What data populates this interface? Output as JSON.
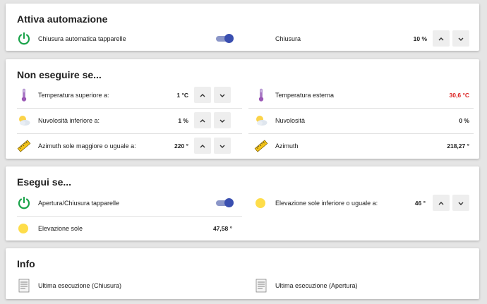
{
  "cards": {
    "automation": {
      "title": "Attiva automazione",
      "auto_close_label": "Chiusura automatica tapparelle",
      "close_label": "Chiusura",
      "close_value": "10 %"
    },
    "do_not_run": {
      "title": "Non eseguire se...",
      "temp_above_label": "Temperatura superiore a:",
      "temp_above_value": "1 °C",
      "temp_ext_label": "Temperatura esterna",
      "temp_ext_value": "30,6 °C",
      "cloud_below_label": "Nuvolosità inferiore a:",
      "cloud_below_value": "1 %",
      "cloud_label": "Nuvolosità",
      "cloud_value": "0 %",
      "azimuth_ge_label": "Azimuth sole maggiore o uguale a:",
      "azimuth_ge_value": "220 °",
      "azimuth_label": "Azimuth",
      "azimuth_value": "218,27 °"
    },
    "run_if": {
      "title": "Esegui se...",
      "open_close_label": "Apertura/Chiusura tapparelle",
      "elev_below_label": "Elevazione sole inferiore o uguale a:",
      "elev_below_value": "46 °",
      "elev_label": "Elevazione sole",
      "elev_value": "47,58 °"
    },
    "info": {
      "title": "Info",
      "last_close_label": "Ultima esecuzione (Chiusura)",
      "last_open_label": "Ultima esecuzione (Apertura)"
    }
  },
  "icons": {
    "power": "power-icon",
    "thermometer": "thermometer-icon",
    "cloudy_sun": "partly-cloudy-icon",
    "compass_ruler": "azimuth-ruler-icon",
    "sun": "sun-icon",
    "document": "document-icon",
    "up": "chevron-up-icon",
    "down": "chevron-down-icon"
  },
  "colors": {
    "accent": "#3a4fb0",
    "power_green": "#1aa34a",
    "alert_red": "#db1f1f",
    "sun_yellow": "#fedd4a"
  },
  "toggles": {
    "auto_close": true,
    "open_close": true
  }
}
